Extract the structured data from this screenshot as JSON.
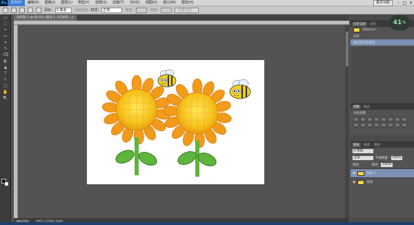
{
  "app": {
    "logo": "Ps",
    "workspace": "基本功能"
  },
  "menu": [
    "文件(F)",
    "编辑(E)",
    "图像(I)",
    "图层(L)",
    "类型(Y)",
    "选择(S)",
    "滤镜(T)",
    "3D(D)",
    "视图(V)",
    "窗口(W)",
    "帮助(H)"
  ],
  "window_buttons": [
    "–",
    "□",
    "✕"
  ],
  "options": {
    "feather_label": "羽化:",
    "feather_value": "0 像素",
    "antialias_label": "消除锯齿",
    "style_label": "样式:",
    "style_value": "正常",
    "width_label": "宽度:",
    "height_label": "高度:",
    "refine_button": "调整边缘..."
  },
  "document": {
    "tab_title": "未标题-1 @ 68.6% (图层 1, RGB/8)",
    "tab_close": "×"
  },
  "status": {
    "zoom": "68.67%",
    "doc_info": "文档:1.07M/1.94M"
  },
  "tools": [
    "▭",
    "⬚",
    "⌖",
    "✂",
    "⌗",
    "✎",
    "⌫",
    "◐",
    "▲",
    "T",
    "↖",
    "▢",
    "✋",
    "🔍"
  ],
  "history_panel": {
    "tabs": [
      "历史记录",
      "动作"
    ],
    "snapshot_label": "10bacon...",
    "items": [
      "打开",
      "通过拷贝的图层"
    ]
  },
  "adjust_panel": {
    "tabs": [
      "调整",
      "样式"
    ],
    "title": "添加调整"
  },
  "layers_panel": {
    "tabs": [
      "图层",
      "通道",
      "路径"
    ],
    "kind_label": "ρ 类型",
    "blend_mode": "正常",
    "opacity_label": "不透明度:",
    "opacity_value": "100%",
    "lock_label": "锁定:",
    "fill_label": "填充:",
    "fill_value": "100%",
    "layers": [
      {
        "name": "图层 1",
        "selected": true
      },
      {
        "name": "背景",
        "selected": false
      }
    ]
  },
  "badge": {
    "value": "41",
    "unit": "%"
  },
  "colors": {
    "accent": "#3a7bd5",
    "selection": "#7c8fb4",
    "petal": "#f29a1a",
    "center": "#f6c21c",
    "leaf": "#5fb53c"
  }
}
